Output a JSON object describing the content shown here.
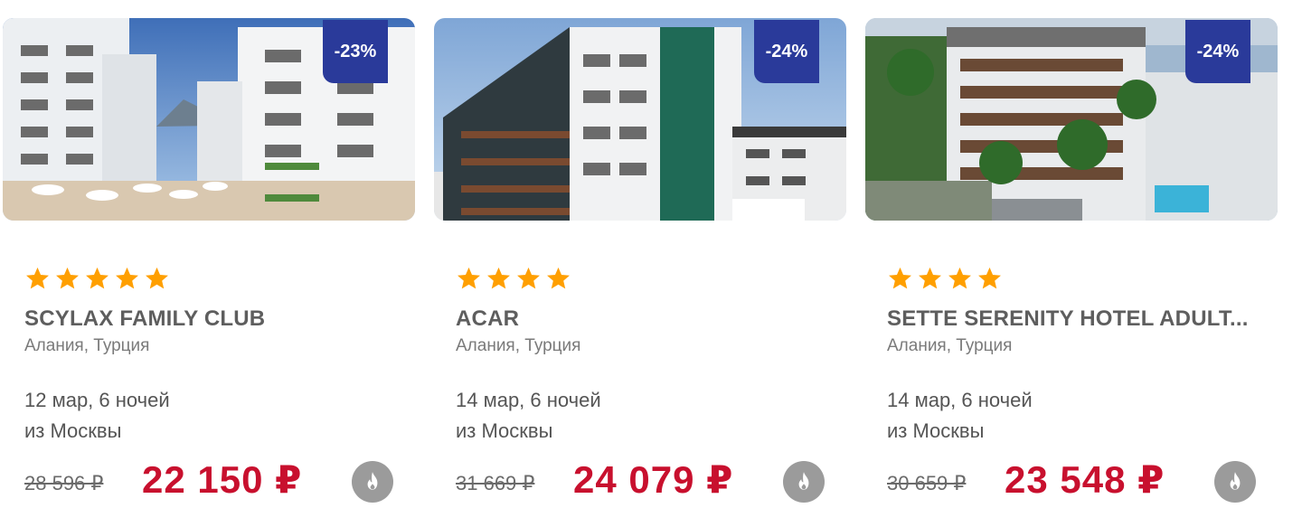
{
  "colors": {
    "badge": "#2a3a9a",
    "star": "#ff9f00",
    "price": "#c8102e",
    "hot_icon_bg": "#9b9b9b"
  },
  "cards": [
    {
      "discount": "-23%",
      "rating": 5,
      "name": "SCYLAX FAMILY CLUB",
      "location": "Алания, Турция",
      "dates": "12 мар, 6 ночей",
      "origin": "из Москвы",
      "old_price": "28 596 ₽",
      "price": "22 150 ₽",
      "hot_icon": "flame-icon"
    },
    {
      "discount": "-24%",
      "rating": 4,
      "name": "ACAR",
      "location": "Алания, Турция",
      "dates": "14 мар, 6 ночей",
      "origin": "из Москвы",
      "old_price": "31 669 ₽",
      "price": "24 079 ₽",
      "hot_icon": "flame-icon"
    },
    {
      "discount": "-24%",
      "rating": 4,
      "name": "SETTE SERENITY HOTEL ADULT...",
      "location": "Алания, Турция",
      "dates": "14 мар, 6 ночей",
      "origin": "из Москвы",
      "old_price": "30 659 ₽",
      "price": "23 548 ₽",
      "hot_icon": "flame-icon"
    }
  ]
}
